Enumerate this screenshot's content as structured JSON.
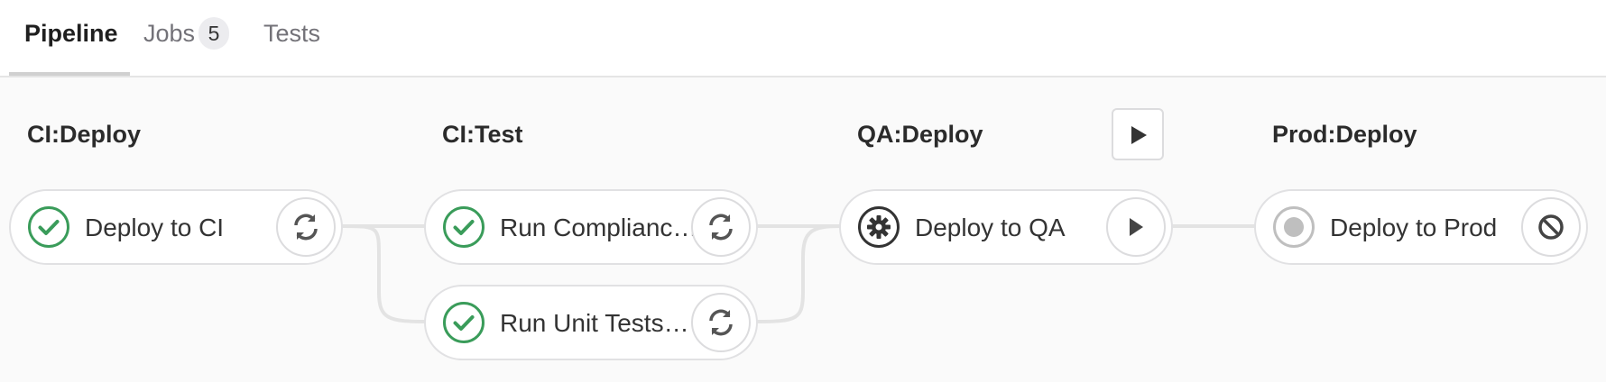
{
  "tabs": {
    "pipeline": "Pipeline",
    "jobs": "Jobs",
    "jobs_count": "5",
    "tests": "Tests"
  },
  "stages": [
    {
      "title": "CI:Deploy"
    },
    {
      "title": "CI:Test"
    },
    {
      "title": "QA:Deploy",
      "action_icon": "play-icon"
    },
    {
      "title": "Prod:Deploy"
    }
  ],
  "jobs": [
    {
      "name": "Deploy to CI",
      "status": "success",
      "action_icon": "retry-icon"
    },
    {
      "name": "Run Compliance Tests",
      "status": "success",
      "action_icon": "retry-icon"
    },
    {
      "name": "Run Unit Tests on CI",
      "status": "success",
      "action_icon": "retry-icon"
    },
    {
      "name": "Deploy to QA",
      "status": "manual",
      "action_icon": "play-icon"
    },
    {
      "name": "Deploy to Prod",
      "status": "created",
      "action_icon": "cancel-icon"
    }
  ],
  "colors": {
    "success": "#3a9c5a",
    "manual": "#333333",
    "created": "#bfbfbf",
    "connector": "#e3e3e3"
  }
}
